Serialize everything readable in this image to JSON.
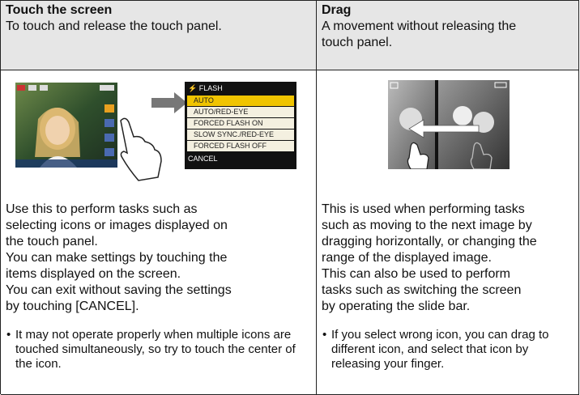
{
  "touch": {
    "title": "Touch the screen",
    "subtitle": "To touch and release the touch panel.",
    "body": "Use this to perform tasks such as\nselecting icons or images displayed on\nthe touch panel.\nYou can make settings by touching the\nitems displayed on the screen.\nYou can exit without saving the settings\nby touching [CANCEL].",
    "bullet": "It may not operate properly when multiple icons are touched simultaneously, so try to touch the center of the icon.",
    "menu": {
      "header": "FLASH",
      "items": [
        "AUTO",
        "AUTO/RED-EYE",
        "FORCED FLASH ON",
        "SLOW SYNC./RED-EYE",
        "FORCED FLASH OFF"
      ],
      "cancel": "CANCEL"
    }
  },
  "drag": {
    "title": "Drag",
    "subtitle": "A movement without releasing the\ntouch panel.",
    "body": "This is used when performing tasks\nsuch as moving to the next image by\ndragging horizontally, or changing the\nrange of the displayed image.\nThis can also be used to perform\ntasks such as switching the screen\nby operating the slide bar.",
    "bullet": "If you select wrong icon, you can drag to different icon, and select that icon by releasing your finger."
  }
}
